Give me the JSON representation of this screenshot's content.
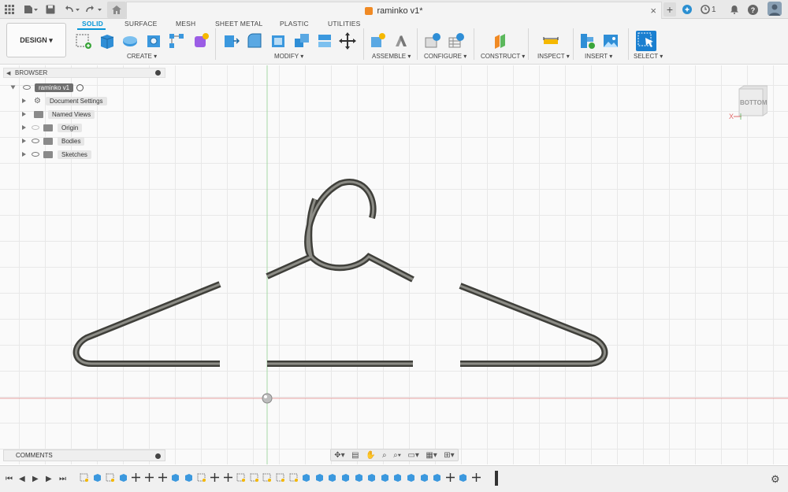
{
  "document_title": "raminko v1*",
  "title_bar_badge": "1",
  "workspace_button": "DESIGN ▾",
  "tabs": [
    "SOLID",
    "SURFACE",
    "MESH",
    "SHEET METAL",
    "PLASTIC",
    "UTILITIES"
  ],
  "active_tab": "SOLID",
  "groups": [
    "CREATE ▾",
    "MODIFY ▾",
    "ASSEMBLE ▾",
    "CONFIGURE ▾",
    "CONSTRUCT ▾",
    "INSPECT ▾",
    "INSERT ▾",
    "SELECT ▾"
  ],
  "browser": {
    "title": "BROWSER",
    "root": "raminko v1",
    "items": [
      "Document Settings",
      "Named Views",
      "Origin",
      "Bodies",
      "Sketches"
    ]
  },
  "comments_title": "COMMENTS",
  "viewcube_label": "BOTTOM",
  "axis_label": "X",
  "colors": {
    "accent": "#0696d7",
    "accent_orange": "#f08a24",
    "axis_red": "#e06a6a",
    "axis_green": "#7fc27f",
    "pipe": "#5b5b55"
  },
  "icons": {
    "titlebar": [
      "apps-grid-icon",
      "file-menu-icon",
      "save-icon",
      "undo-icon",
      "redo-icon",
      "home-icon",
      "new-tab-plus-icon",
      "extension-icon",
      "job-status-icon",
      "notification-bell-icon",
      "help-icon",
      "avatar-icon"
    ],
    "timeline": [
      "go-to-start-icon",
      "previous-step-icon",
      "play-icon",
      "next-step-icon",
      "go-to-end-icon",
      "settings-gear-icon"
    ]
  }
}
